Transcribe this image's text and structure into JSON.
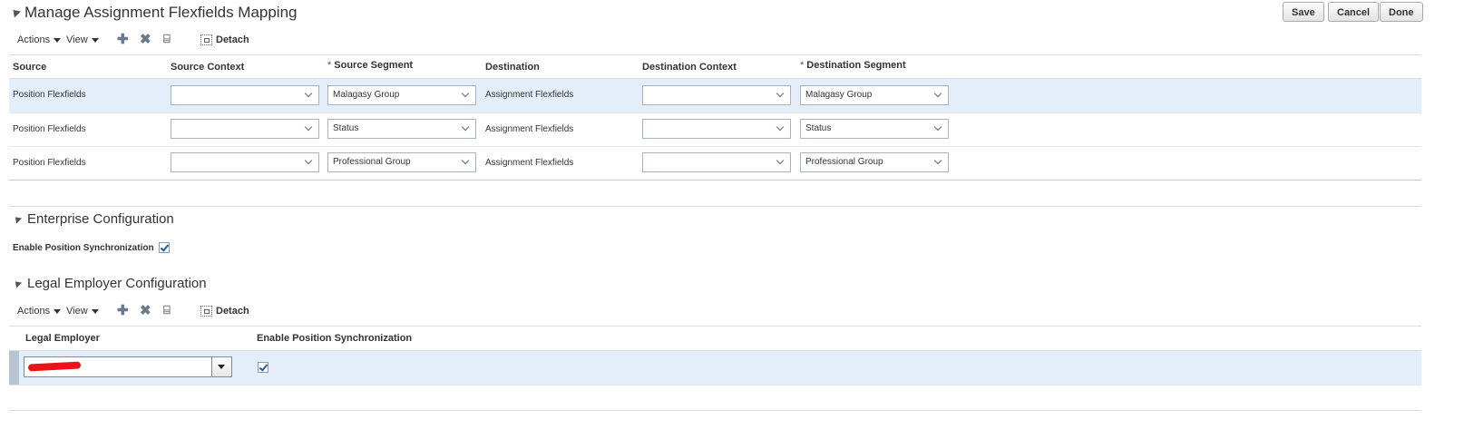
{
  "page": {
    "title": "Manage Assignment Flexfields Mapping",
    "buttons": {
      "save": "Save",
      "cancel": "Cancel",
      "done": "Done"
    }
  },
  "toolbar": {
    "actions": "Actions",
    "view": "View",
    "add_icon": "add-icon",
    "delete_icon": "delete-icon",
    "freeze_icon": "freeze-icon",
    "detach_label": "Detach"
  },
  "mapping_table": {
    "columns": {
      "source": "Source",
      "source_context": "Source Context",
      "source_segment": "Source Segment",
      "destination": "Destination",
      "destination_context": "Destination Context",
      "destination_segment": "Destination Segment"
    },
    "required_marker": "*",
    "rows": [
      {
        "source": "Position Flexfields",
        "source_context": "",
        "source_segment": "Malagasy Group",
        "destination": "Assignment Flexfields",
        "destination_context": "",
        "destination_segment": "Malagasy Group"
      },
      {
        "source": "Position Flexfields",
        "source_context": "",
        "source_segment": "Status",
        "destination": "Assignment Flexfields",
        "destination_context": "",
        "destination_segment": "Status"
      },
      {
        "source": "Position Flexfields",
        "source_context": "",
        "source_segment": "Professional Group",
        "destination": "Assignment Flexfields",
        "destination_context": "",
        "destination_segment": "Professional Group"
      }
    ]
  },
  "enterprise": {
    "title": "Enterprise Configuration",
    "enable_label": "Enable Position Synchronization",
    "enable_checked": true
  },
  "legal_employer": {
    "title": "Legal Employer Configuration",
    "columns": {
      "legal_employer": "Legal Employer",
      "enable": "Enable Position Synchronization"
    },
    "rows": [
      {
        "legal_employer": "",
        "enable_checked": true
      }
    ]
  },
  "colors": {
    "selected_row": "#e4eef9",
    "required_marker": "#2b5b9e",
    "check": "#1f5fa7",
    "redaction": "#e8141a"
  }
}
